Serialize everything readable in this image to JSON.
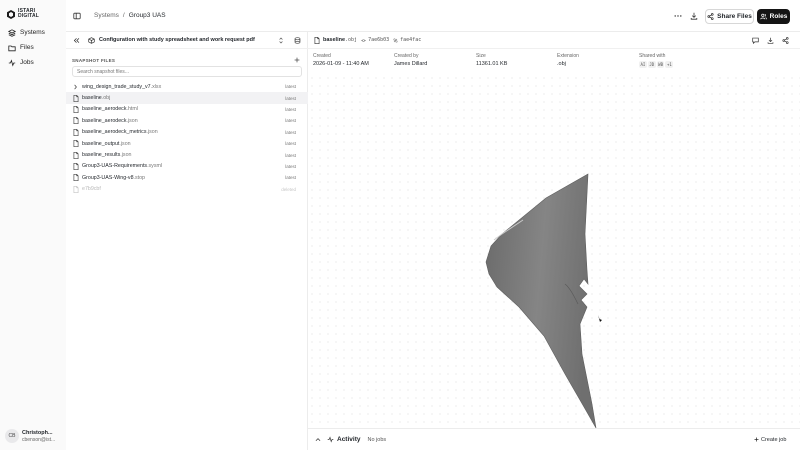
{
  "brand": {
    "line1": "ISTARI",
    "line2": "DIGITAL"
  },
  "nav": [
    {
      "label": "Systems",
      "icon": "layers-icon"
    },
    {
      "label": "Files",
      "icon": "folder-icon"
    },
    {
      "label": "Jobs",
      "icon": "activity-icon"
    }
  ],
  "user": {
    "initials": "CB",
    "name": "Christoph...",
    "email": "cbenson@ist..."
  },
  "breadcrumb": {
    "root": "Systems",
    "separator": "/",
    "current": "Group3 UAS"
  },
  "header": {
    "share_label": "Share Files",
    "roles_label": "Roles"
  },
  "config": {
    "title": "Configuration with study spreadsheet and work request pdf"
  },
  "snapshot": {
    "label": "SNAPSHOT FILES",
    "search_placeholder": "Search snapshot files..."
  },
  "files": [
    {
      "name": "wing_design_trade_study_v7",
      "ext": ".xlsx",
      "tag": "latest"
    },
    {
      "name": "baseline",
      "ext": ".obj",
      "tag": "latest"
    },
    {
      "name": "baseline_aerodeck",
      "ext": ".html",
      "tag": "latest"
    },
    {
      "name": "baseline_aerodeck",
      "ext": ".json",
      "tag": "latest"
    },
    {
      "name": "baseline_aerodeck_metrics",
      "ext": ".json",
      "tag": "latest"
    },
    {
      "name": "baseline_output",
      "ext": ".json",
      "tag": "latest"
    },
    {
      "name": "baseline_results",
      "ext": ".json",
      "tag": "latest"
    },
    {
      "name": "Group3-UAS-Requirements",
      "ext": ".sysml",
      "tag": "latest"
    },
    {
      "name": "Group3-UAS-Wing-v8",
      "ext": ".stop",
      "tag": "latest"
    },
    {
      "name": "e7b9cbf",
      "ext": "",
      "tag": "deleted"
    }
  ],
  "file_view": {
    "name": "baseline",
    "ext": ".obj",
    "hash1": "7ae6b03",
    "hash2": "fae4fac",
    "created_label": "Created",
    "created": "2026-01-09 - 11:40 AM",
    "created_by_label": "Created by",
    "created_by": "James Dillard",
    "size_label": "Size",
    "size": "11361.01 KB",
    "extension_label": "Extension",
    "extension": ".obj",
    "shared_label": "Shared with",
    "shared": [
      "AI",
      "JD",
      "WB",
      "+1"
    ]
  },
  "activity": {
    "label": "Activity",
    "status": "No jobs",
    "create_label": "Create job"
  },
  "colors": {
    "accent_dark": "#151515",
    "selected_row": "#f2f2f4",
    "wing_fill": "#7f7f7f"
  }
}
